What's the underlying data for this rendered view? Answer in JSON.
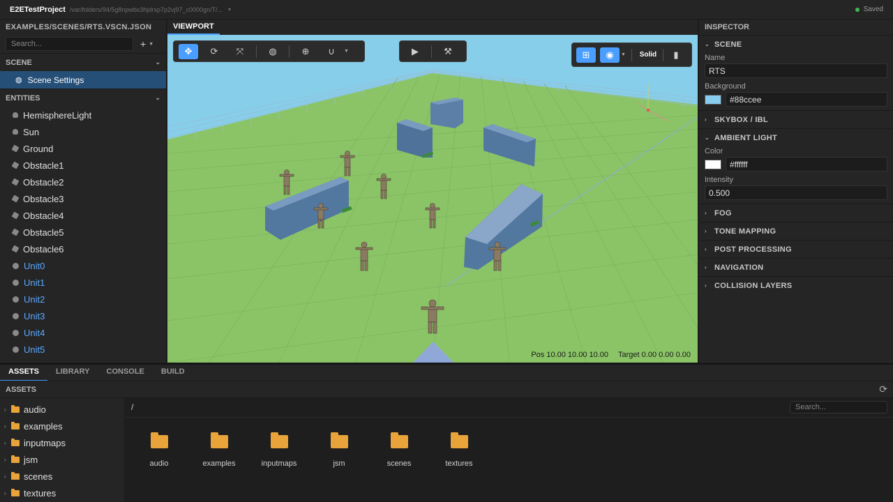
{
  "titlebar": {
    "project": "E2ETestProject",
    "path": "/var/folders/94/5g8npwbx3hjdrxp7p2vj97_c0000gn/T/...",
    "status": "Saved"
  },
  "left_panel": {
    "title": "EXAMPLES/SCENES/RTS.VSCN.JSON",
    "search_placeholder": "Search...",
    "scene_section": "SCENE",
    "scene_item": "Scene Settings",
    "entities_section": "ENTITIES",
    "entities": [
      {
        "label": "HemisphereLight",
        "icon": "bulb-icon"
      },
      {
        "label": "Sun",
        "icon": "bulb-icon"
      },
      {
        "label": "Ground",
        "icon": "cube-icon"
      },
      {
        "label": "Obstacle1",
        "icon": "cube-icon"
      },
      {
        "label": "Obstacle2",
        "icon": "cube-icon"
      },
      {
        "label": "Obstacle3",
        "icon": "cube-icon"
      },
      {
        "label": "Obstacle4",
        "icon": "cube-icon"
      },
      {
        "label": "Obstacle5",
        "icon": "cube-icon"
      },
      {
        "label": "Obstacle6",
        "icon": "cube-icon"
      },
      {
        "label": "Unit0",
        "icon": "circle-icon"
      },
      {
        "label": "Unit1",
        "icon": "circle-icon"
      },
      {
        "label": "Unit2",
        "icon": "circle-icon"
      },
      {
        "label": "Unit3",
        "icon": "circle-icon"
      },
      {
        "label": "Unit4",
        "icon": "circle-icon"
      },
      {
        "label": "Unit5",
        "icon": "circle-icon"
      }
    ]
  },
  "viewport": {
    "tab": "VIEWPORT",
    "shading_mode": "Solid",
    "pos_readout": "Pos 10.00 10.00 10.00",
    "target_readout": "Target 0.00 0.00 0.00",
    "sky_color": "#87ceeb",
    "ground_color": "#8bc467"
  },
  "inspector": {
    "title": "INSPECTOR",
    "scene_section": "SCENE",
    "name_label": "Name",
    "name_value": "RTS",
    "background_label": "Background",
    "background_value": "#88ccee",
    "skybox_section": "SKYBOX / IBL",
    "ambient_section": "AMBIENT LIGHT",
    "color_label": "Color",
    "color_value": "#ffffff",
    "intensity_label": "Intensity",
    "intensity_value": "0.500",
    "collapsed_sections": [
      "FOG",
      "TONE MAPPING",
      "POST PROCESSING",
      "NAVIGATION",
      "COLLISION LAYERS"
    ]
  },
  "bottom": {
    "tabs": [
      "ASSETS",
      "LIBRARY",
      "CONSOLE",
      "BUILD"
    ],
    "assets_title": "ASSETS",
    "breadcrumb": "/",
    "search_placeholder": "Search...",
    "folders": [
      "audio",
      "examples",
      "inputmaps",
      "jsm",
      "scenes",
      "textures"
    ]
  },
  "colors": {
    "accent": "#4a9eff",
    "selection": "#264f78",
    "unit_text": "#5aa9ff",
    "folder": "#e8a43a",
    "saved_dot": "#3fb950"
  }
}
